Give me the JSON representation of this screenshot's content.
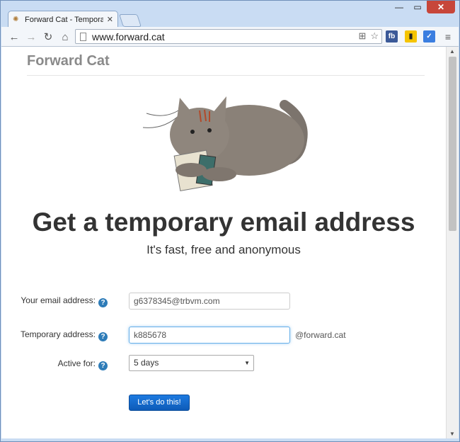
{
  "browser": {
    "tab_title": "Forward Cat - Temporar",
    "url": "www.forward.cat",
    "window_controls": {
      "minimize": "—",
      "maximize": "▭",
      "close": "✕"
    },
    "extensions": [
      {
        "name": "fb",
        "color": "#3b5998"
      },
      {
        "name": "phone-ext",
        "color": "#f5c400"
      },
      {
        "name": "check-ext",
        "color": "#3b7ee0"
      }
    ]
  },
  "page": {
    "brand": "Forward Cat",
    "headline": "Get a temporary email address",
    "subheadline": "It's fast, free and anonymous",
    "form": {
      "email_label": "Your email address:",
      "email_value": "g6378345@trbvm.com",
      "temp_label": "Temporary address:",
      "temp_value": "k885678",
      "temp_suffix": "@forward.cat",
      "active_label": "Active for:",
      "active_value": "5 days",
      "submit_label": "Let's do this!"
    }
  }
}
